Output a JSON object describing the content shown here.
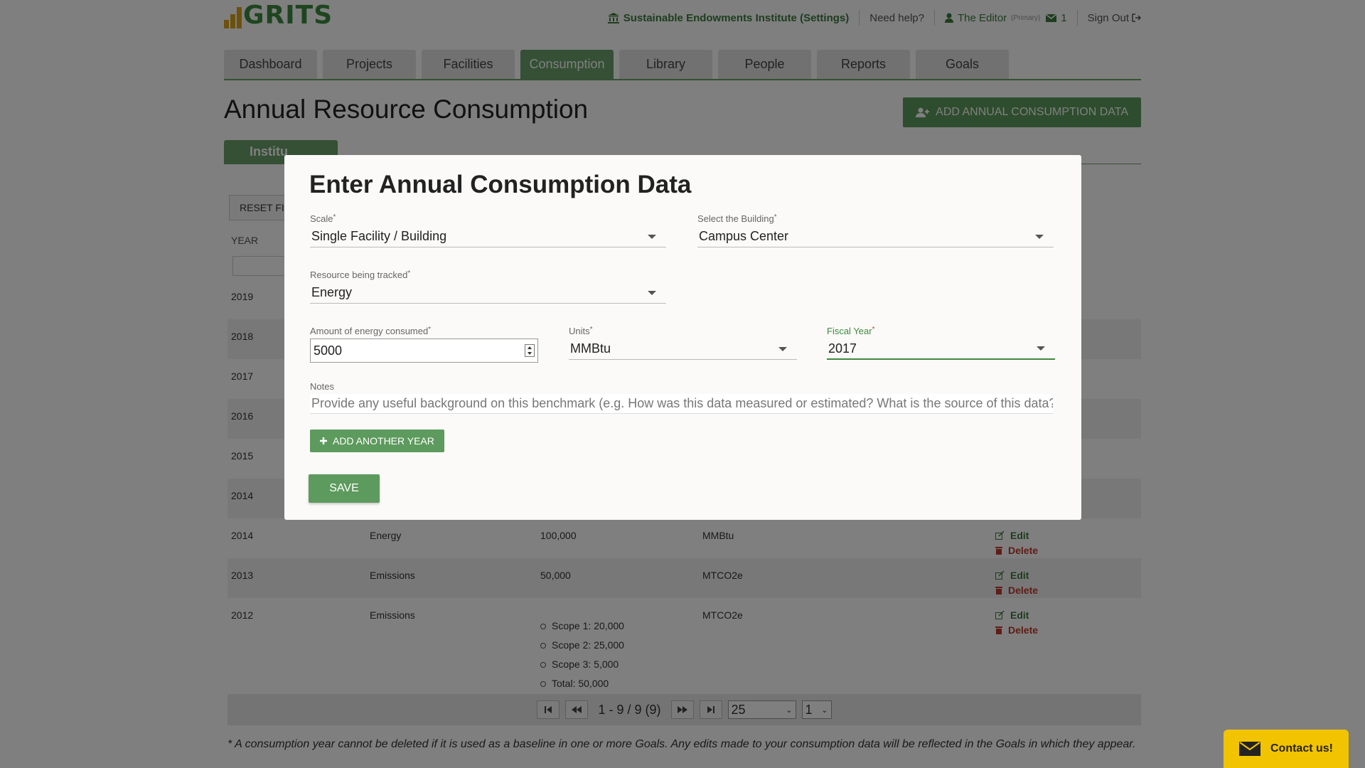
{
  "header": {
    "logo_text": "GRITS",
    "org_link": "Sustainable Endowments Institute (Settings)",
    "help_link": "Need help?",
    "user_name": "The Editor",
    "user_role": "(Primary)",
    "mail_count": "1",
    "sign_out": "Sign Out"
  },
  "nav_tabs": [
    {
      "label": "Dashboard"
    },
    {
      "label": "Projects"
    },
    {
      "label": "Facilities"
    },
    {
      "label": "Consumption",
      "active": true
    },
    {
      "label": "Library"
    },
    {
      "label": "People"
    },
    {
      "label": "Reports"
    },
    {
      "label": "Goals"
    }
  ],
  "page": {
    "title": "Annual Resource Consumption",
    "add_button": "ADD ANNUAL CONSUMPTION DATA",
    "sub_tab": "Institu",
    "reset_button": "RESET FILT",
    "year_header": "YEAR"
  },
  "table": {
    "rows": [
      {
        "year": "2019"
      },
      {
        "year": "2018"
      },
      {
        "year": "2017"
      },
      {
        "year": "2016"
      },
      {
        "year": "2015"
      },
      {
        "year": "2014"
      },
      {
        "year": "2014",
        "resource": "Energy",
        "amount": "100,000",
        "units": "MMBtu",
        "edit": "Edit",
        "delete": "Delete"
      },
      {
        "year": "2013",
        "resource": "Emissions",
        "amount": "50,000",
        "units": "MTCO2e",
        "edit": "Edit",
        "delete": "Delete"
      },
      {
        "year": "2012",
        "resource": "Emissions",
        "units": "MTCO2e",
        "edit": "Edit",
        "delete": "Delete",
        "scopes": [
          "Scope 1: 20,000",
          "Scope 2: 25,000",
          "Scope 3: 5,000",
          "Total: 50,000"
        ]
      }
    ]
  },
  "pager": {
    "range_text": "1 - 9 / 9 (9)",
    "page_size": "25",
    "page_number": "1"
  },
  "footnote": "* A consumption year cannot be deleted if it is used as a baseline in one or more Goals. Any edits made to your consumption data will be reflected in the Goals in which they appear.",
  "contact": {
    "label": "Contact us!"
  },
  "modal": {
    "title": "Enter Annual Consumption Data",
    "scale": {
      "label": "Scale",
      "value": "Single Facility / Building"
    },
    "building": {
      "label": "Select the Building",
      "value": "Campus Center"
    },
    "resource": {
      "label": "Resource being tracked",
      "value": "Energy"
    },
    "amount": {
      "label": "Amount of energy consumed",
      "value": "5000"
    },
    "units": {
      "label": "Units",
      "value": "MMBtu"
    },
    "fiscal_year": {
      "label": "Fiscal Year",
      "value": "2017"
    },
    "notes": {
      "label": "Notes",
      "placeholder": "Provide any useful background on this benchmark (e.g. How was this data measured or estimated? What is the source of this data?)"
    },
    "add_year_button": "ADD ANOTHER YEAR",
    "save_button": "SAVE",
    "required_marker": "*"
  },
  "colors": {
    "brand_green": "#6aa06a",
    "button_green": "#5d9a5d",
    "logo_gold": "#d9a21b",
    "delete_red": "#c0392b",
    "contact_yellow": "#f2c300"
  }
}
